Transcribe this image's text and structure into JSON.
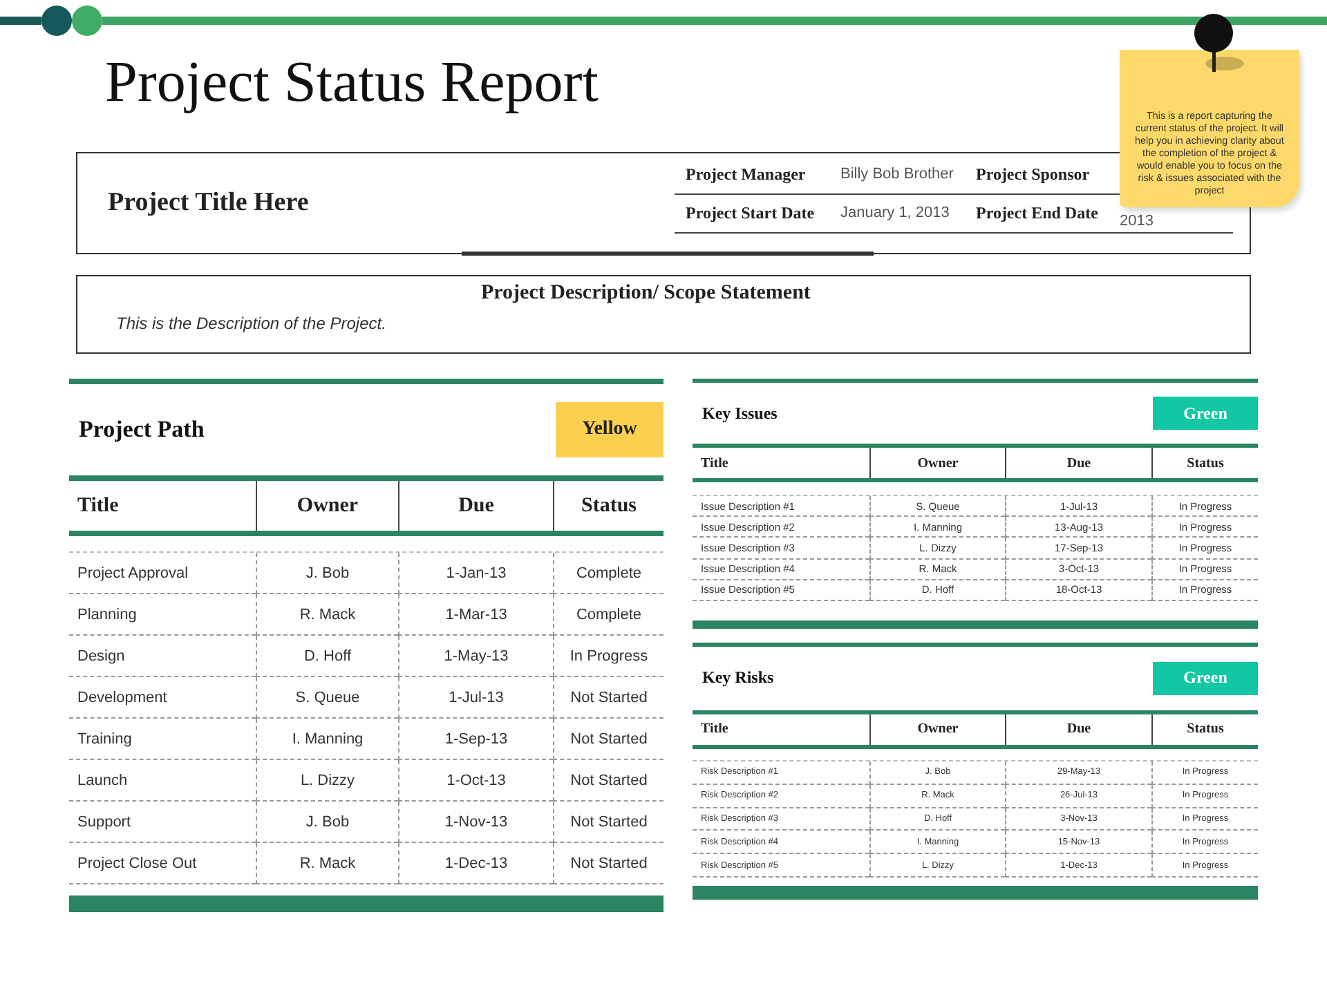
{
  "title": "Project Status Report",
  "info": {
    "project_title": "Project Title Here",
    "fields": [
      {
        "label": "Project Manager",
        "value": "Billy Bob Brother"
      },
      {
        "label": "Project Sponsor"
      },
      {
        "label": "Project Start Date",
        "value": "January 1, 2013"
      },
      {
        "label": "Project End Date",
        "value": "2013"
      }
    ]
  },
  "description": {
    "heading": "Project Description/ Scope Statement",
    "text": "This is the Description of the Project."
  },
  "sticky_note": {
    "text": "This is a report capturing the current status of the project. It will help you in achieving clarity about the completion of the project & would enable you to focus on the risk & issues associated with the project"
  },
  "panels": [
    {
      "kind": "large",
      "title": "Project Path",
      "status": {
        "label": "Yellow",
        "color": "#fcd04f"
      },
      "columns": [
        "Title",
        "Owner",
        "Due",
        "Status"
      ],
      "rows": [
        [
          "Project Approval",
          "J. Bob",
          "1-Jan-13",
          "Complete"
        ],
        [
          "Planning",
          "R. Mack",
          "1-Mar-13",
          "Complete"
        ],
        [
          "Design",
          "D. Hoff",
          "1-May-13",
          "In Progress"
        ],
        [
          "Development",
          "S. Queue",
          "1-Jul-13",
          "Not Started"
        ],
        [
          "Training",
          "I. Manning",
          "1-Sep-13",
          "Not Started"
        ],
        [
          "Launch",
          "L. Dizzy",
          "1-Oct-13",
          "Not Started"
        ],
        [
          "Support",
          "J. Bob",
          "1-Nov-13",
          "Not Started"
        ],
        [
          "Project Close Out",
          "R. Mack",
          "1-Dec-13",
          "Not Started"
        ]
      ]
    },
    {
      "kind": "small",
      "title": "Key Issues",
      "status": {
        "label": "Green",
        "color": "#12c8a4"
      },
      "columns": [
        "Title",
        "Owner",
        "Due",
        "Status"
      ],
      "rows": [
        [
          "Issue Description #1",
          "S. Queue",
          "1-Jul-13",
          "In Progress"
        ],
        [
          "Issue Description #2",
          "I. Manning",
          "13-Aug-13",
          "In Progress"
        ],
        [
          "Issue Description #3",
          "L. Dizzy",
          "17-Sep-13",
          "In Progress"
        ],
        [
          "Issue Description #4",
          "R. Mack",
          "3-Oct-13",
          "In Progress"
        ],
        [
          "Issue Description #5",
          "D. Hoff",
          "18-Oct-13",
          "In Progress"
        ]
      ]
    },
    {
      "kind": "tiny",
      "title": "Key Risks",
      "status": {
        "label": "Green",
        "color": "#12c8a4"
      },
      "columns": [
        "Title",
        "Owner",
        "Due",
        "Status"
      ],
      "rows": [
        [
          "Risk Description #1",
          "J. Bob",
          "29-May-13",
          "In Progress"
        ],
        [
          "Risk Description #2",
          "R. Mack",
          "26-Jul-13",
          "In Progress"
        ],
        [
          "Risk Description #3",
          "D. Hoff",
          "3-Nov-13",
          "In Progress"
        ],
        [
          "Risk Description #4",
          "I. Manning",
          "15-Nov-13",
          "In Progress"
        ],
        [
          "Risk Description #5",
          "L. Dizzy",
          "1-Dec-13",
          "In Progress"
        ]
      ]
    }
  ]
}
